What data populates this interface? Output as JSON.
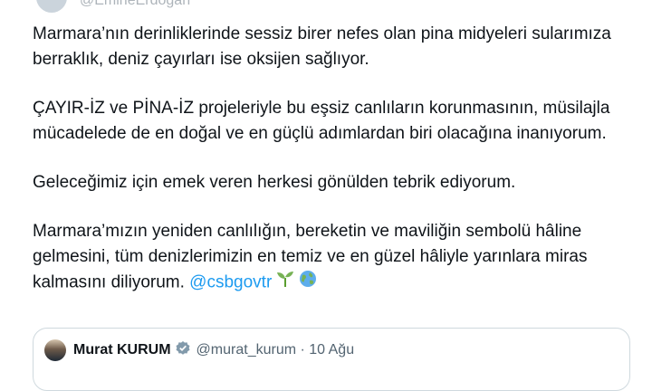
{
  "header": {
    "handle": "@EmineErdogan"
  },
  "tweet": {
    "paragraphs": [
      "Marmara’nın derinliklerinde sessiz birer nefes olan pina midyeleri sularımıza berraklık, deniz çayırları ise oksijen sağlıyor.",
      "ÇAYIR-İZ ve PİNA-İZ projeleriyle bu eşsiz canlıların korunmasının, müsilajla mücadelede de en doğal ve en güçlü adımlardan biri olacağına inanıyorum.",
      "Geleceğimiz için emek veren herkesi gönülden tebrik ediyorum.",
      "Marmara’mızın yeniden canlılığın, bereketin ve maviliğin sembolü hâline gelmesini, tüm denizlerimizin en temiz ve en güzel hâliyle yarınlara miras kalmasını diliyorum."
    ],
    "mention": "@csbgovtr",
    "emojis": [
      "seedling-icon",
      "globe-icon"
    ]
  },
  "quote": {
    "name": "Murat KURUM",
    "handle": "@murat_kurum · 10 Ağu"
  },
  "colors": {
    "link": "#1d9bf0",
    "text": "#0f1419",
    "muted": "#536471",
    "border": "#cfd9de"
  }
}
